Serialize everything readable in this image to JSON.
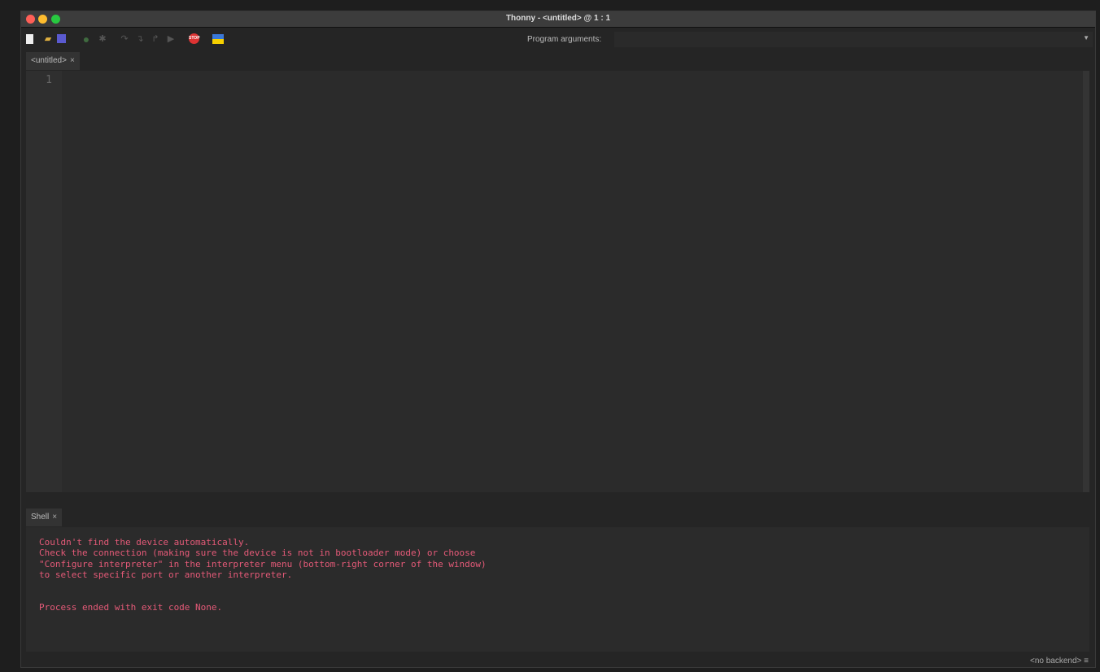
{
  "window": {
    "title": "Thonny  -  <untitled>  @  1 : 1"
  },
  "toolbar": {
    "items": [
      {
        "name": "new-file-icon",
        "glyph": "▯"
      },
      {
        "name": "open-file-icon",
        "glyph": "📂"
      },
      {
        "name": "save-icon",
        "glyph": "💾"
      },
      {
        "name": "run-icon",
        "glyph": "●"
      },
      {
        "name": "debug-icon",
        "glyph": "✱"
      },
      {
        "name": "step-over-icon",
        "glyph": "↷"
      },
      {
        "name": "step-into-icon",
        "glyph": "↴"
      },
      {
        "name": "step-out-icon",
        "glyph": "↱"
      },
      {
        "name": "resume-icon",
        "glyph": "▶"
      },
      {
        "name": "stop-icon",
        "glyph": "STOP"
      },
      {
        "name": "ukraine-flag-icon",
        "glyph": ""
      }
    ],
    "program_arguments_label": "Program arguments:",
    "program_arguments_value": ""
  },
  "editor": {
    "tab_label": "<untitled>",
    "close": "×",
    "line_numbers": [
      "1"
    ]
  },
  "shell": {
    "tab_label": "Shell",
    "close": "×",
    "output": "Couldn't find the device automatically.\nCheck the connection (making sure the device is not in bootloader mode) or choose\n\"Configure interpreter\" in the interpreter menu (bottom-right corner of the window)\nto select specific port or another interpreter.\n\n\nProcess ended with exit code None."
  },
  "status": {
    "backend": "<no backend>",
    "menu_glyph": "≡"
  },
  "colors": {
    "error_text": "#e55a78"
  }
}
